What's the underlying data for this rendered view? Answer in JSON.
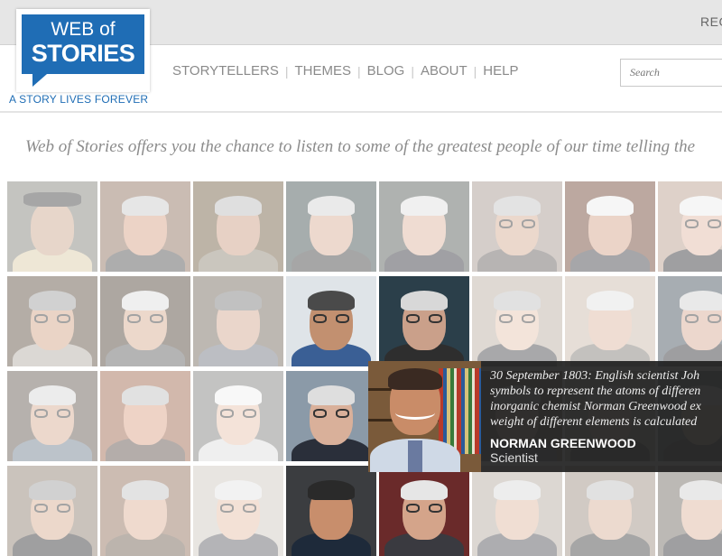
{
  "header": {
    "register_label": "REG",
    "logo": {
      "line1": "WEB of",
      "line2": "STORIES",
      "tagline": "A STORY LIVES FOREVER"
    },
    "nav": [
      {
        "label": "STORYTELLERS"
      },
      {
        "label": "THEMES"
      },
      {
        "label": "BLOG"
      },
      {
        "label": "ABOUT"
      },
      {
        "label": "HELP"
      }
    ],
    "search": {
      "placeholder": "Search"
    }
  },
  "intro": {
    "text": "Web of Stories offers you the chance to listen to some of the greatest people of our time telling the"
  },
  "popup": {
    "lines": [
      "30 September 1803: English scientist Joh",
      "symbols to represent the atoms of differen",
      "inorganic chemist Norman Greenwood ex",
      "weight of different elements is calculated"
    ],
    "name": "NORMAN GREENWOOD",
    "role": "Scientist"
  },
  "colors": {
    "brand": "#1f6db5",
    "nav_text": "#8a8a8a",
    "popup_bg": "#1c1c1c"
  },
  "storytellers": [
    {
      "bg": "#7d7d74",
      "skin": "#c9a58a",
      "hair": "#3a3a3a",
      "shirt": "#d9c9a4",
      "glasses": false,
      "hat": true
    },
    {
      "bg": "#8a6a58",
      "skin": "#d49d82",
      "hair": "#c8c8c8",
      "shirt": "#4a4a4a",
      "glasses": false,
      "hat": false
    },
    {
      "bg": "#6e5a3c",
      "skin": "#c99a7e",
      "hair": "#b8b8b8",
      "shirt": "#8a8070",
      "glasses": false,
      "hat": false
    },
    {
      "bg": "#3a4a4a",
      "skin": "#d7aa93",
      "hair": "#d0d0d0",
      "shirt": "#3a3a3a",
      "glasses": false,
      "hat": false
    },
    {
      "bg": "#4e5650",
      "skin": "#dcb29c",
      "hair": "#dedede",
      "shirt": "#2e2e35",
      "glasses": false,
      "hat": false
    },
    {
      "bg": "#a3928a",
      "skin": "#d3a88f",
      "hair": "#c0c0c0",
      "shirt": "#605a58",
      "glasses": true,
      "hat": false
    },
    {
      "bg": "#6a3e2e",
      "skin": "#d2a085",
      "hair": "#ececec",
      "shirt": "#3a3a40",
      "glasses": false,
      "hat": false
    },
    {
      "bg": "#b59a88",
      "skin": "#e1b7a2",
      "hair": "#eaeaea",
      "shirt": "#2a2a30",
      "glasses": true,
      "hat": false
    },
    {
      "bg": "#5a4a3a",
      "skin": "#d0a080",
      "hair": "#9a9a9a",
      "shirt": "#b0a8a0",
      "glasses": true,
      "hat": false
    },
    {
      "bg": "#4a3c30",
      "skin": "#d5a98c",
      "hair": "#dcdcdc",
      "shirt": "#5a5a5a",
      "glasses": true,
      "hat": false
    },
    {
      "bg": "#6e6256",
      "skin": "#d1a58c",
      "hair": "#777777",
      "shirt": "#6a6f7a",
      "glasses": false,
      "hat": false
    },
    {
      "bg": "#dfe4e8",
      "skin": "#c29070",
      "hair": "#4a4a4a",
      "shirt": "#3a5f95",
      "glasses": true,
      "hat": false
    },
    {
      "bg": "#2b3f4a",
      "skin": "#caa08a",
      "hair": "#d8d8d8",
      "shirt": "#2e2e2e",
      "glasses": true,
      "hat": false
    },
    {
      "bg": "#b8ab9e",
      "skin": "#e5c3ad",
      "hair": "#bcbcbc",
      "shirt": "#3e3e44",
      "glasses": true,
      "hat": false
    },
    {
      "bg": "#c7b7a6",
      "skin": "#dbb49e",
      "hair": "#e0e0e0",
      "shirt": "#7a7670",
      "glasses": false,
      "hat": false
    },
    {
      "bg": "#3c4a55",
      "skin": "#d4a690",
      "hair": "#cfcfcf",
      "shirt": "#28282e",
      "glasses": true,
      "hat": false
    },
    {
      "bg": "#5e524a",
      "skin": "#d5a88e",
      "hair": "#d6d6d6",
      "shirt": "#6a7a8a",
      "glasses": true,
      "hat": false
    },
    {
      "bg": "#9c6248",
      "skin": "#d99d82",
      "hair": "#bdbdbd",
      "shirt": "#5a4a44",
      "glasses": false,
      "hat": false
    },
    {
      "bg": "#7a7a78",
      "skin": "#e6c2aa",
      "hair": "#f0f0f0",
      "shirt": "#dcdcdc",
      "glasses": true,
      "hat": false
    },
    {
      "bg": "#8b9aa8",
      "skin": "#d9b09a",
      "hair": "#dedede",
      "shirt": "#2a2f3a",
      "glasses": true,
      "hat": false
    },
    {
      "bg": "#6a584a",
      "skin": "#d3a78d",
      "hair": "#bbbbbb",
      "shirt": "#4a4a4a",
      "glasses": false,
      "hat": false
    },
    {
      "bg": "#5a4838",
      "skin": "#d2a488",
      "hair": "#c4c4c4",
      "shirt": "#505055",
      "glasses": false,
      "hat": false
    },
    {
      "bg": "#a6978a",
      "skin": "#e0b9a0",
      "hair": "#d2d2d2",
      "shirt": "#3a3a3a",
      "glasses": false,
      "hat": false
    },
    {
      "bg": "#4b5a62",
      "skin": "#d6aa92",
      "hair": "#cacaca",
      "shirt": "#303036",
      "glasses": false,
      "hat": false
    },
    {
      "bg": "#8a7a6a",
      "skin": "#d4a88c",
      "hair": "#9a9a9a",
      "shirt": "#2a2a2e",
      "glasses": true,
      "hat": false
    },
    {
      "bg": "#8e6a56",
      "skin": "#dcae92",
      "hair": "#c2c2c2",
      "shirt": "#6a5a4a",
      "glasses": false,
      "hat": false
    },
    {
      "bg": "#cdc6bc",
      "skin": "#e4bda4",
      "hair": "#e2e2e2",
      "shirt": "#5a5a60",
      "glasses": true,
      "hat": false
    },
    {
      "bg": "#3b3d40",
      "skin": "#c88e6c",
      "hair": "#2a2a2a",
      "shirt": "#1e2a3a",
      "glasses": false,
      "hat": false
    },
    {
      "bg": "#6a2a2a",
      "skin": "#d4a48a",
      "hair": "#e6e6e6",
      "shirt": "#3a3a40",
      "glasses": true,
      "hat": false
    },
    {
      "bg": "#b2a79c",
      "skin": "#ddb69e",
      "hair": "#d8d8d8",
      "shirt": "#4a4a50",
      "glasses": false,
      "hat": false
    },
    {
      "bg": "#9a8b7c",
      "skin": "#d6ad94",
      "hair": "#bcbcbc",
      "shirt": "#3a3a3a",
      "glasses": false,
      "hat": false
    },
    {
      "bg": "#6a645c",
      "skin": "#dcb29a",
      "hair": "#cfcfcf",
      "shirt": "#2a2a30",
      "glasses": false,
      "hat": false
    }
  ]
}
